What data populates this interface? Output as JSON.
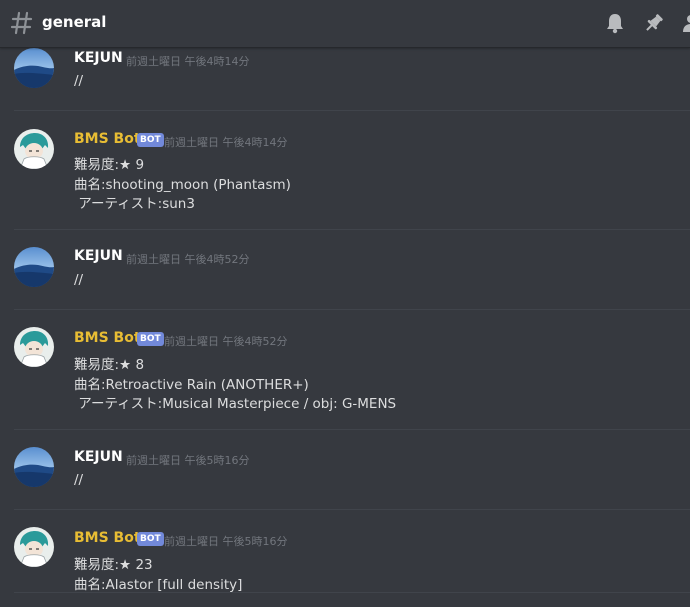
{
  "header": {
    "channel_name": "general",
    "hash_icon": "hashtag-icon",
    "icons": [
      "bell-icon",
      "pin-icon",
      "members-icon"
    ]
  },
  "messages": [
    {
      "author": "KEJUN",
      "is_bot": false,
      "timestamp": "前週土曜日 午後4時14分",
      "lines": [
        "//"
      ]
    },
    {
      "author": "BMS Bot",
      "is_bot": true,
      "bot_tag": "BOT",
      "timestamp": "前週土曜日 午後4時14分",
      "lines": [
        "難易度:★ 9",
        "曲名:shooting_moon (Phantasm)",
        " アーティスト:sun3"
      ]
    },
    {
      "author": "KEJUN",
      "is_bot": false,
      "timestamp": "前週土曜日 午後4時52分",
      "lines": [
        "//"
      ]
    },
    {
      "author": "BMS Bot",
      "is_bot": true,
      "bot_tag": "BOT",
      "timestamp": "前週土曜日 午後4時52分",
      "lines": [
        "難易度:★ 8",
        "曲名:Retroactive Rain (ANOTHER+)",
        " アーティスト:Musical Masterpiece / obj: G-MENS"
      ]
    },
    {
      "author": "KEJUN",
      "is_bot": false,
      "timestamp": "前週土曜日 午後5時16分",
      "lines": [
        "//"
      ]
    },
    {
      "author": "BMS Bot",
      "is_bot": true,
      "bot_tag": "BOT",
      "timestamp": "前週土曜日 午後5時16分",
      "lines": [
        "難易度:★ 23",
        "曲名:Alastor [full density]"
      ]
    }
  ],
  "colors": {
    "background": "#36393f",
    "bot_name": "#e8bd34",
    "bot_tag": "#7289da",
    "timestamp": "#72767d",
    "text": "#dcddde"
  }
}
